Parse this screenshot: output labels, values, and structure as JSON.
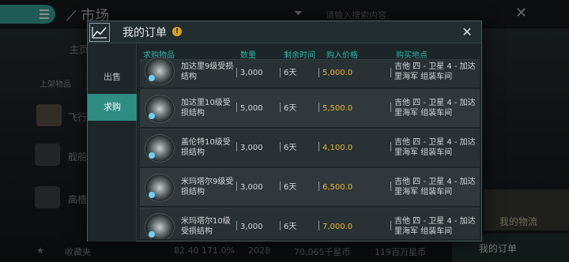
{
  "background": {
    "title": "市场",
    "search_placeholder": "请输入搜索内容",
    "sidebar": {
      "main_label": "主页",
      "section_label": "上架物品",
      "items": [
        "飞行",
        "舰船",
        "高槽"
      ],
      "favorites": "收藏夹"
    },
    "bottom": {
      "item1": "82.40 171.0%",
      "item2": "2028",
      "item3": "70,065千星币",
      "item4": "119百万星币"
    },
    "right_card_label": "我的物流",
    "my_orders_button": "我的订单"
  },
  "modal": {
    "title": "我的订单",
    "info_icon": "!",
    "close_icon": "✕",
    "tabs": [
      {
        "label": "出售",
        "active": false
      },
      {
        "label": "求购",
        "active": true
      }
    ],
    "columns": {
      "item": "求购物品",
      "qty": "数量",
      "time": "剩余时间",
      "price": "购入价格",
      "location": "购买地点"
    },
    "rows": [
      {
        "name": "加达里9级受损结构",
        "qty": "3,000",
        "time": "6天",
        "price": "5,000.0",
        "location": "吉他 四 - 卫星 4 - 加达里海军 组装车间"
      },
      {
        "name": "加达里10级受损结构",
        "qty": "5,000",
        "time": "6天",
        "price": "5,500.0",
        "location": "吉他 四 - 卫星 4 - 加达里海军 组装车间"
      },
      {
        "name": "盖伦特10级受损结构",
        "qty": "3,000",
        "time": "6天",
        "price": "4,100.0",
        "location": "吉他 四 - 卫星 4 - 加达里海军 组装车间"
      },
      {
        "name": "米玛塔尔9级受损结构",
        "qty": "3,000",
        "time": "6天",
        "price": "6,500.0",
        "location": "吉他 四 - 卫星 4 - 加达里海军 组装车间"
      },
      {
        "name": "米玛塔尔10级受损结构",
        "qty": "3,000",
        "time": "6天",
        "price": "7,000.0",
        "location": "吉他 四 - 卫星 4 - 加达里海军 组装车间"
      }
    ]
  },
  "colors": {
    "accent": "#2f8d82",
    "price": "#e7b43c",
    "header_text": "#2fb3a2"
  }
}
